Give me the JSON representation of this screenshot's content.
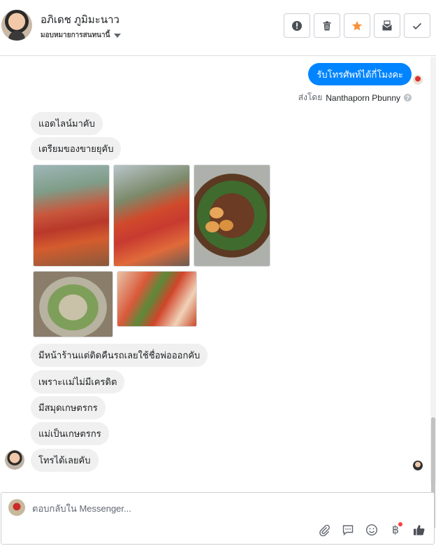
{
  "header": {
    "contact_name": "อภิเดช ภูมิมะนาว",
    "assign_label": "มอบหมายการสนทนานี้",
    "tools": [
      "alert-icon",
      "trash-icon",
      "star-icon",
      "mark-unread-icon",
      "check-icon"
    ],
    "star_color": "#f7923b"
  },
  "thread": {
    "outgoing": {
      "text": "รับโทรศัพท์ได้กี่โมงคะ",
      "sent_by_prefix": "ส่งโดย",
      "sent_by_name": "Nanthaporn Pbunny",
      "bubble_color": "#0084ff"
    },
    "incoming": [
      "แอดไลน์มาคับ",
      "เตรียมของขายยุคับ",
      "มีหน้าร้านแต่ติดคืนรถเลยใช้ชื่อพ่อออกคับ",
      "เพราะเเม่ไม่มีเครดิต",
      "มีสมุดเกษตรกร",
      "แม่เป็นเกษตรกร",
      "โทรได้เลยคับ"
    ],
    "photos": [
      "photo-market-stall-1",
      "photo-market-stall-2",
      "photo-braised-pork-eggs",
      "photo-fish-soup",
      "photo-tom-yum"
    ]
  },
  "composer": {
    "placeholder": "ตอบกลับใน Messenger...",
    "baht_symbol": "฿",
    "icons": [
      "attachment-icon",
      "saved-replies-icon",
      "emoji-icon",
      "payment-icon",
      "like-icon"
    ]
  }
}
